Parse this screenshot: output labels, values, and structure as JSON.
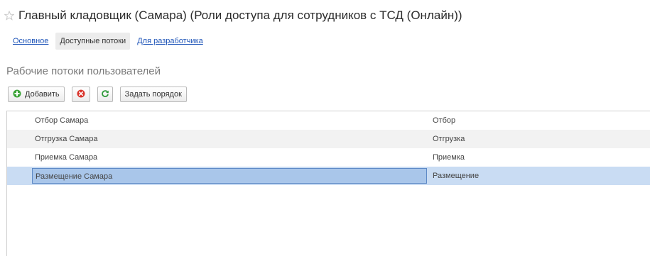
{
  "header": {
    "title": "Главный кладовщик (Самара) (Роли доступа для сотрудников с ТСД (Онлайн))",
    "favorite_icon": "star-outline-icon"
  },
  "tabs": [
    {
      "label": "Основное",
      "state": "link"
    },
    {
      "label": "Доступные потоки",
      "state": "active"
    },
    {
      "label": "Для разработчика",
      "state": "link"
    }
  ],
  "section": {
    "title": "Рабочие потоки пользователей"
  },
  "toolbar": {
    "add_label": "Добавить",
    "add_icon": "add-circle-icon",
    "delete_icon": "delete-circle-icon",
    "refresh_icon": "refresh-icon",
    "order_label": "Задать порядок"
  },
  "table": {
    "rows": [
      {
        "name": "Отбор Самара",
        "type": "Отбор"
      },
      {
        "name": "Отгрузка Самара",
        "type": "Отгрузка"
      },
      {
        "name": "Приемка Самара",
        "type": "Приемка"
      },
      {
        "name": "Размещение Самара",
        "type": "Размещение",
        "selected": true
      }
    ]
  },
  "colors": {
    "link": "#1f55b8",
    "selected_row": "#c9dcf3",
    "selected_cell": "#a9c6ea",
    "add_green": "#3aa336",
    "delete_red": "#d9342b",
    "refresh_green": "#2f9a3a"
  }
}
